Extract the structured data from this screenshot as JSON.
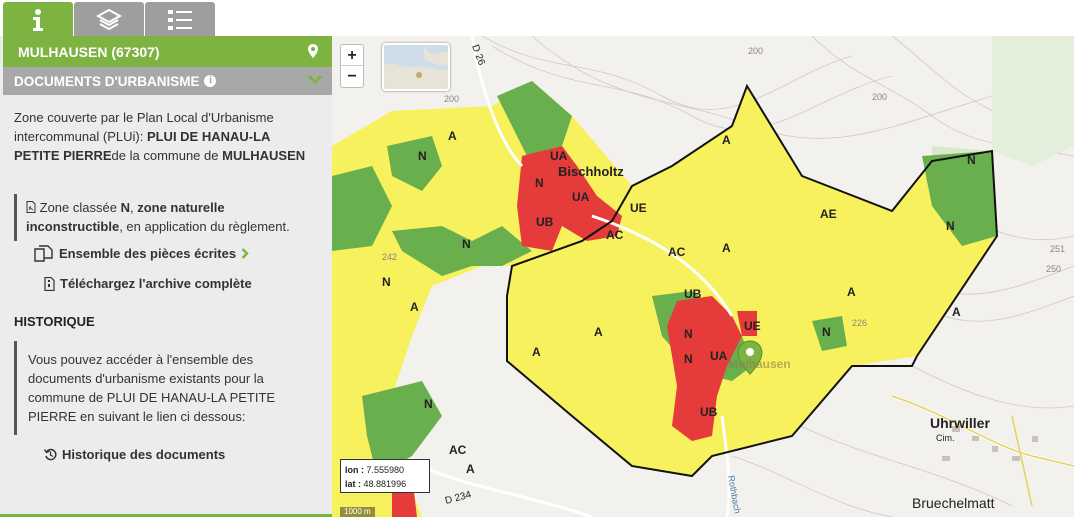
{
  "tabs": [
    {
      "name": "info",
      "icon": "info-icon"
    },
    {
      "name": "layers",
      "icon": "layers-icon"
    },
    {
      "name": "legend",
      "icon": "list-icon"
    }
  ],
  "commune": {
    "title": "MULHAUSEN (67307)",
    "icon": "map-marker-icon"
  },
  "section": {
    "title": "DOCUMENTS D'URBANISME"
  },
  "intro": {
    "p1": "Zone couverte par le Plan Local d'Urbanisme intercommunal (PLUi): ",
    "plan_name": "PLUI DE HANAU-LA PETITE PIERRE",
    "p2": "de la commune de ",
    "commune_name": "MULHAUSEN"
  },
  "zone": {
    "p1": "Zone classée ",
    "code": "N",
    "p2": ", ",
    "label": "zone naturelle inconstructible",
    "p3": ", en application du règlement."
  },
  "links": {
    "pieces": "Ensemble des pièces écrites",
    "archive": "Téléchargez l'archive complète",
    "history": "Historique des documents"
  },
  "historique": {
    "title": "HISTORIQUE",
    "text": "Vous pouvez accéder à l'ensemble des documents d'urbanisme existants pour la commune de PLUI DE HANAU-LA PETITE PIERRE en suivant le lien ci dessous:"
  },
  "map": {
    "zoom_in": "+",
    "zoom_out": "−",
    "coords": {
      "lon_label": "lon :",
      "lon": "7.555980",
      "lat_label": "lat :",
      "lat": "48.881996"
    },
    "scale": "1000 m",
    "place_labels": [
      "Bischholtz",
      "Mulhausen",
      "Uhrwiller",
      "Cim.",
      "Bruechelmatt",
      "Rothbach"
    ],
    "road_labels": [
      "D 26",
      "D 234"
    ],
    "contour_labels": [
      "200",
      "200",
      "200",
      "251",
      "250",
      "226",
      "242"
    ],
    "zone_labels": [
      "A",
      "A",
      "A",
      "A",
      "A",
      "A",
      "A",
      "A",
      "A",
      "N",
      "N",
      "N",
      "N",
      "N",
      "N",
      "N",
      "N",
      "N",
      "N",
      "UA",
      "UA",
      "UA",
      "UB",
      "UB",
      "UB",
      "UE",
      "UE",
      "AC",
      "AC",
      "AC",
      "AE"
    ],
    "colors": {
      "agricultural": "#f7f15d",
      "natural": "#6aaf4d",
      "urban": "#e53b3b",
      "boundary": "#111111"
    }
  }
}
